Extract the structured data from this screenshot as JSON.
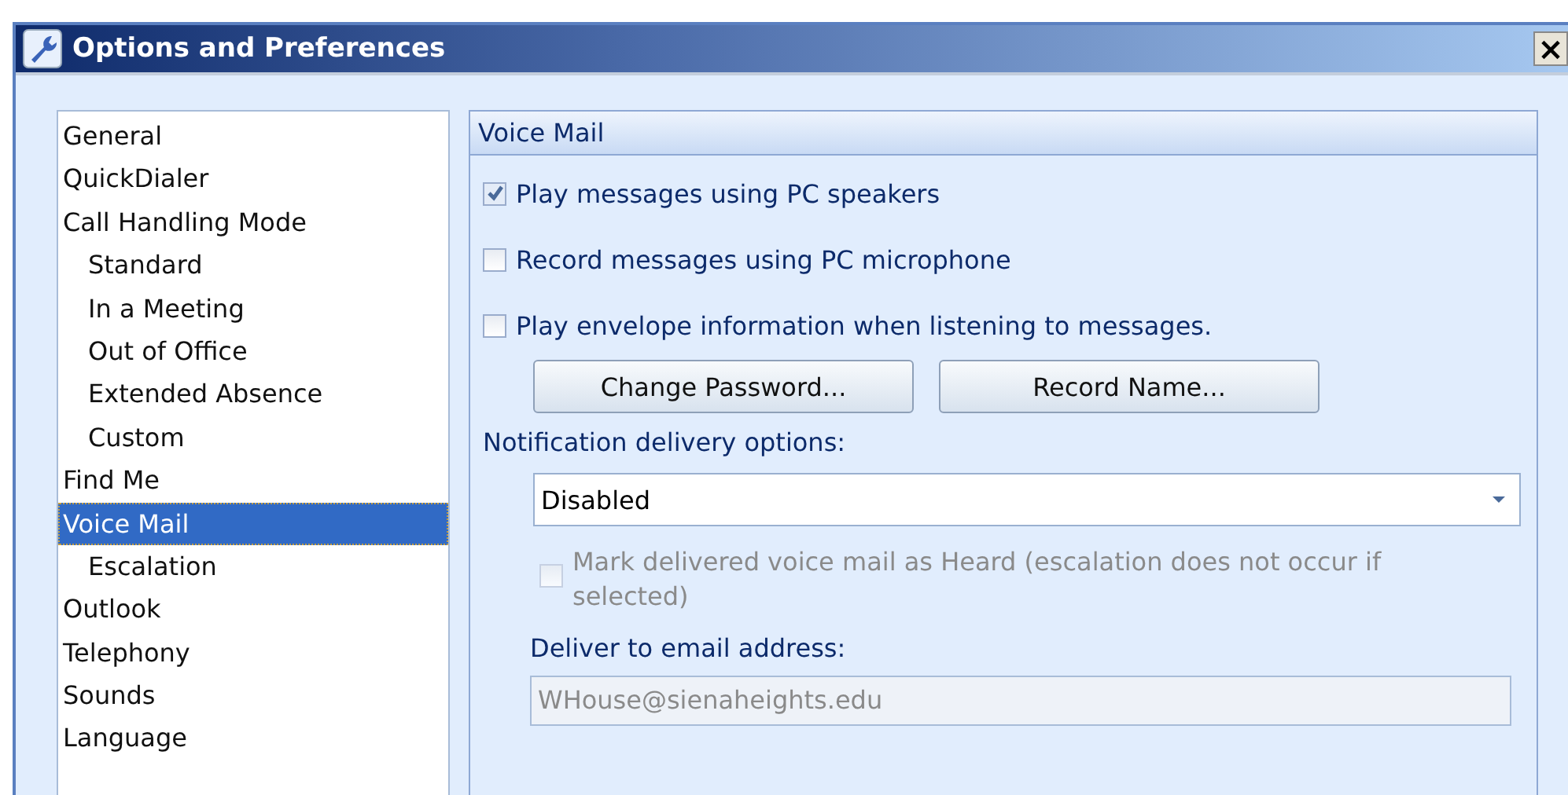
{
  "window": {
    "title": "Options and Preferences",
    "close": "×"
  },
  "sidebar": {
    "items": [
      {
        "label": "General",
        "selected": false
      },
      {
        "label": "QuickDialer",
        "selected": false
      },
      {
        "label": "Call Handling Mode",
        "selected": false,
        "children": [
          {
            "label": "Standard",
            "selected": false
          },
          {
            "label": "In a Meeting",
            "selected": false
          },
          {
            "label": "Out of Office",
            "selected": false
          },
          {
            "label": "Extended Absence",
            "selected": false
          },
          {
            "label": "Custom",
            "selected": false
          }
        ]
      },
      {
        "label": "Find Me",
        "selected": false
      },
      {
        "label": "Voice Mail",
        "selected": true,
        "children": [
          {
            "label": "Escalation",
            "selected": false
          }
        ]
      },
      {
        "label": "Outlook",
        "selected": false
      },
      {
        "label": "Telephony",
        "selected": false
      },
      {
        "label": "Sounds",
        "selected": false
      },
      {
        "label": "Language",
        "selected": false
      }
    ]
  },
  "panel": {
    "title": "Voice Mail",
    "options": [
      {
        "label": "Play messages using PC speakers",
        "checked": true
      },
      {
        "label": "Record messages using PC microphone",
        "checked": false
      },
      {
        "label": "Play envelope information when listening to messages.",
        "checked": false
      }
    ],
    "buttons": [
      "Change Password...",
      "Record Name..."
    ],
    "notification_label": "Notification delivery options:",
    "notification_dropdown": {
      "value": "Disabled"
    },
    "mark_heard": {
      "label": "Mark delivered voice mail as Heard (escalation does not occur if selected)",
      "checked": false,
      "disabled": true
    },
    "email_label": "Deliver to email address:",
    "email_field": {
      "value": "WHouse@sienaheights.edu",
      "disabled": true
    }
  }
}
